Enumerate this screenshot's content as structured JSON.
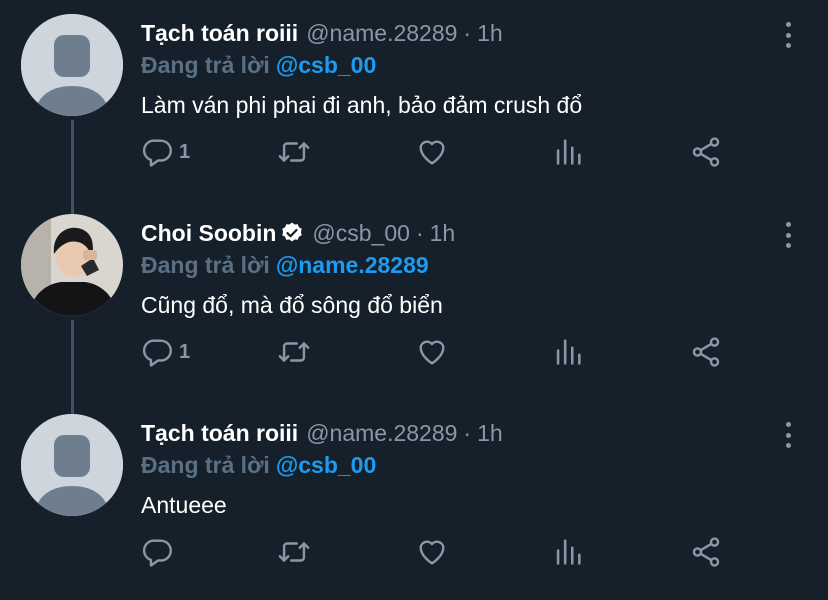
{
  "tweets": [
    {
      "display_name": "Tạch toán roiii",
      "verified": false,
      "handle": "@name.28289",
      "separator": "·",
      "time": "1h",
      "reply_prefix": "Đang trả lời",
      "reply_to": "@csb_00",
      "text": "Làm ván phi phai đi anh, bảo đảm crush đổ",
      "reply_count": "1",
      "avatar": "default-avatar"
    },
    {
      "display_name": "Choi Soobin",
      "verified": true,
      "handle": "@csb_00",
      "separator": "·",
      "time": "1h",
      "reply_prefix": "Đang trả lời",
      "reply_to": "@name.28289",
      "text": "Cũng đổ, mà đổ sông đổ biển",
      "reply_count": "1",
      "avatar": "profile-photo"
    },
    {
      "display_name": "Tạch toán roiii",
      "verified": false,
      "handle": "@name.28289",
      "separator": "·",
      "time": "1h",
      "reply_prefix": "Đang trả lời",
      "reply_to": "@csb_00",
      "text": "Antueee",
      "reply_count": "",
      "avatar": "default-avatar"
    }
  ],
  "icons": {
    "reply": "reply-icon",
    "retweet": "retweet-icon",
    "like": "heart-icon",
    "analytics": "analytics-icon",
    "share": "share-icon",
    "more": "more-icon",
    "verified": "verified-badge-icon"
  },
  "colors": {
    "background": "#15202b",
    "text": "#ffffff",
    "secondary": "#8899a6",
    "reply_prefix": "#5b7083",
    "link": "#1d9bf0",
    "thread_line": "#3d5466"
  }
}
